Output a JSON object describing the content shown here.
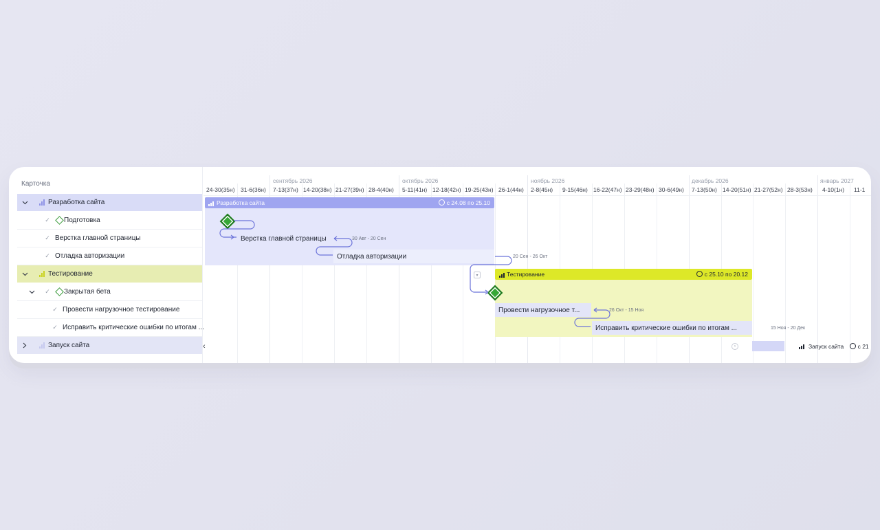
{
  "left_panel": {
    "header": "Карточка",
    "rows": [
      {
        "label": "Разработка сайта"
      },
      {
        "label": "Подготовка"
      },
      {
        "label": "Верстка главной страницы"
      },
      {
        "label": "Отладка авторизации"
      },
      {
        "label": "Тестирование"
      },
      {
        "label": "Закрытая бета"
      },
      {
        "label": "Провести нагрузочное тестирование"
      },
      {
        "label": "Исправить критические ошибки по итогам ..."
      },
      {
        "label": "Запуск сайта"
      }
    ]
  },
  "timeline": {
    "months": [
      "сентябрь 2026",
      "октябрь 2026",
      "ноябрь 2026",
      "декабрь 2026",
      "январь 2027"
    ],
    "weeks": [
      "24-30(35н)",
      "31-6(36н)",
      "7-13(37н)",
      "14-20(38н)",
      "21-27(39н)",
      "28-4(40н)",
      "5-11(41н)",
      "12-18(42н)",
      "19-25(43н)",
      "26-1(44н)",
      "2-8(45н)",
      "9-15(46н)",
      "16-22(47н)",
      "23-29(48н)",
      "30-6(49н)",
      "7-13(50н)",
      "14-20(51н)",
      "21-27(52н)",
      "28-3(53н)",
      "4-10(1н)",
      "11-1"
    ],
    "group1": {
      "title": "Разработка сайта",
      "dates": "с 24.08 по 25.10"
    },
    "group2": {
      "title": "Тестирование",
      "dates": "с 25.10 по 20.12"
    },
    "group3": {
      "title": "Запуск сайта",
      "dates": "с 21"
    },
    "tasks": {
      "t1": "Верстка главной страницы",
      "t1_dates": "30 Авг - 20 Сен",
      "t2": "Отладка авторизации",
      "t2_dates": "20 Сен - 26 Окт",
      "t3": "Провести нагрузочное т...",
      "t3_dates": "26 Окт - 15 Ноя",
      "t4": "Исправить критические ошибки по итогам ...",
      "t4_dates": "15 Ноя - 20 Дек"
    }
  },
  "colors": {
    "group1": "#9fa5f0",
    "group1_area": "#e4e6fb",
    "group2": "#dde828",
    "group2_area": "#f2f6c0",
    "milestone": "#37a837",
    "arrow": "#6b73d9"
  }
}
